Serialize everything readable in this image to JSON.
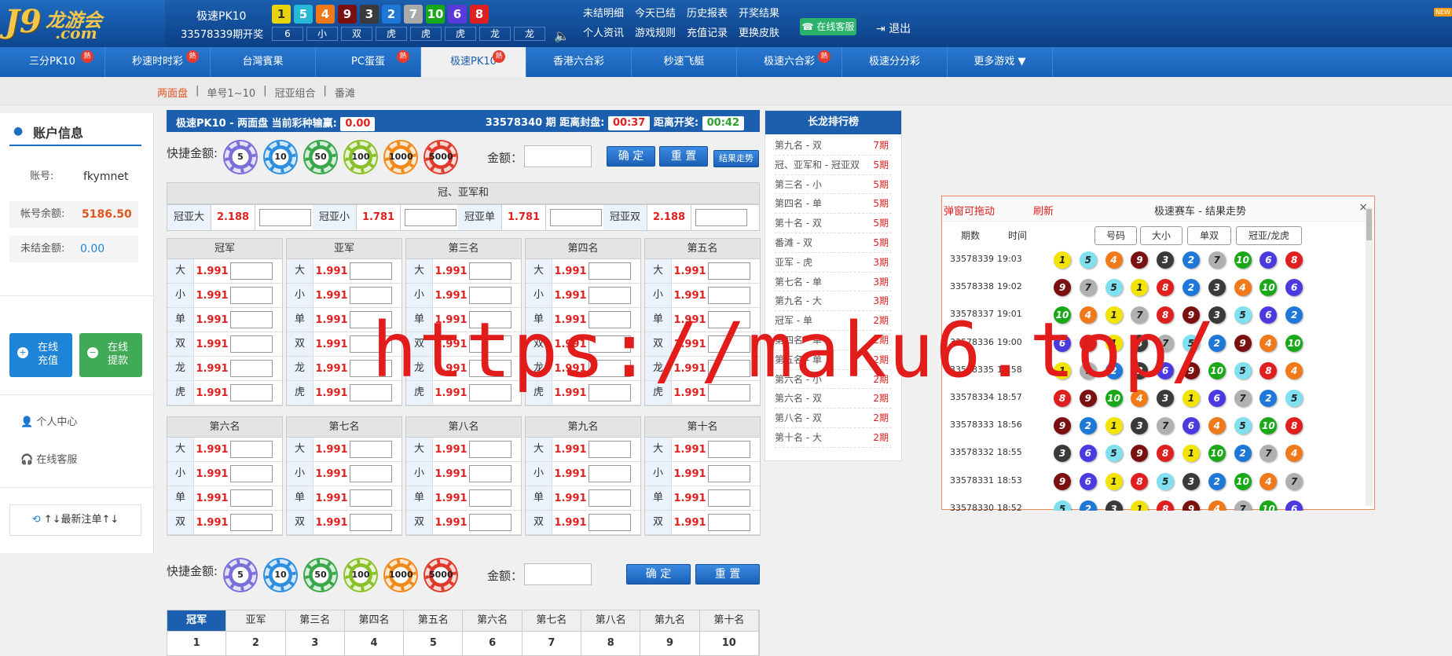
{
  "header": {
    "logo_main": "J9",
    "logo_sub": "龙游会",
    "logo_dot": ".com",
    "game": "极速PK10",
    "issue_open": "33578339期开奖",
    "balls": [
      {
        "n": "1",
        "c": "#e8d40a"
      },
      {
        "n": "5",
        "c": "#27b8d8"
      },
      {
        "n": "4",
        "c": "#f07a1a"
      },
      {
        "n": "9",
        "c": "#7a1010"
      },
      {
        "n": "3",
        "c": "#3a3a3a"
      },
      {
        "n": "2",
        "c": "#1e78d8"
      },
      {
        "n": "7",
        "c": "#aaaaaa"
      },
      {
        "n": "10",
        "c": "#18a818"
      },
      {
        "n": "6",
        "c": "#5a3ad8"
      },
      {
        "n": "8",
        "c": "#e02020"
      }
    ],
    "labels": [
      "6",
      "小",
      "双",
      "虎",
      "虎",
      "虎",
      "龙",
      "龙"
    ],
    "links": [
      "未结明细",
      "今天已结",
      "历史报表",
      "开奖结果",
      "个人资讯",
      "游戏规则",
      "充值记录",
      "更换皮肤"
    ],
    "service": "在线客服",
    "logout": "退出",
    "new_tag": "NEW"
  },
  "nav": [
    {
      "label": "三分PK10",
      "hot": true
    },
    {
      "label": "秒速时时彩",
      "hot": true
    },
    {
      "label": "台灣賓果",
      "hot": false
    },
    {
      "label": "PC蛋蛋",
      "hot": true
    },
    {
      "label": "极速PK10",
      "hot": true,
      "active": true
    },
    {
      "label": "香港六合彩",
      "hot": false
    },
    {
      "label": "秒速飞艇",
      "hot": false
    },
    {
      "label": "极速六合彩",
      "hot": true
    },
    {
      "label": "极速分分彩",
      "hot": false
    },
    {
      "label": "更多游戏 ▼",
      "hot": false
    }
  ],
  "hot_label": "熱",
  "subnav": {
    "items": [
      "两面盘",
      "单号1~10",
      "冠亚组合",
      "番滩"
    ],
    "sep": "|"
  },
  "sidebar": {
    "title": "账户信息",
    "account_k": "账号:",
    "account_v": "fkymnet",
    "balance_k": "帐号余额:",
    "balance_v": "5186.50",
    "unsettled_k": "未结金额:",
    "unsettled_v": "0.00",
    "recharge": "在线充值",
    "withdraw": "在线提款",
    "center": "个人中心",
    "support": "在线客服",
    "latest": "↑↓最新注单↑↓"
  },
  "mainbar": {
    "left": "极速PK10 - 两面盘  当前彩种输赢:",
    "winloss": "0.00",
    "issue": "33578340 期 距离封盘:",
    "close": "00:37",
    "open_lbl": "距离开奖:",
    "open": "00:42"
  },
  "quick": {
    "label": "快捷金额:",
    "chips": [
      "5",
      "10",
      "50",
      "100",
      "1000",
      "5000"
    ],
    "amount_label": "金额：",
    "confirm": "确 定",
    "reset": "重 置",
    "trend": "结果走势"
  },
  "gy": {
    "title": "冠、亚军和",
    "items": [
      [
        "冠亚大",
        "2.188"
      ],
      [
        "冠亚小",
        "1.781"
      ],
      [
        "冠亚单",
        "1.781"
      ],
      [
        "冠亚双",
        "2.188"
      ]
    ]
  },
  "groups_top": [
    "冠军",
    "亚军",
    "第三名",
    "第四名",
    "第五名"
  ],
  "groups_bottom": [
    "第六名",
    "第七名",
    "第八名",
    "第九名",
    "第十名"
  ],
  "keys_top": [
    "大",
    "小",
    "单",
    "双",
    "龙",
    "虎"
  ],
  "keys_bottom": [
    "大",
    "小",
    "单",
    "双"
  ],
  "odds": "1.991",
  "bottom_tabs": [
    "冠军",
    "亚军",
    "第三名",
    "第四名",
    "第五名",
    "第六名",
    "第七名",
    "第八名",
    "第九名",
    "第十名"
  ],
  "bottom_nums": [
    "1",
    "2",
    "3",
    "4",
    "5",
    "6",
    "7",
    "8",
    "9",
    "10"
  ],
  "longdragon": {
    "title": "长龙排行榜",
    "items": [
      [
        "第九名 - 双",
        "7期"
      ],
      [
        "冠、亚军和 - 冠亚双",
        "5期"
      ],
      [
        "第三名 - 小",
        "5期"
      ],
      [
        "第四名 - 单",
        "5期"
      ],
      [
        "第十名 - 双",
        "5期"
      ],
      [
        "番滩 - 双",
        "5期"
      ],
      [
        "亚军 - 虎",
        "3期"
      ],
      [
        "第七名 - 单",
        "3期"
      ],
      [
        "第九名 - 大",
        "3期"
      ],
      [
        "冠军 - 单",
        "2期"
      ],
      [
        "第四名 - 单",
        "2期"
      ],
      [
        "第五名 - 单",
        "2期"
      ],
      [
        "第六名 - 小",
        "2期"
      ],
      [
        "第六名 - 双",
        "2期"
      ],
      [
        "第八名 - 双",
        "2期"
      ],
      [
        "第十名 - 大",
        "2期"
      ]
    ]
  },
  "popup": {
    "drag": "弹窗可拖动",
    "refresh": "刷新",
    "title": "极速赛车 - 结果走势",
    "close": "×",
    "col_issue": "期数",
    "col_time": "时间",
    "tabs": [
      "号码",
      "大小",
      "单双",
      "冠亚/龙虎"
    ],
    "rows": [
      {
        "issue": "33578339",
        "time": "19:03",
        "b": [
          1,
          5,
          4,
          9,
          3,
          2,
          7,
          10,
          6,
          8
        ]
      },
      {
        "issue": "33578338",
        "time": "19:02",
        "b": [
          9,
          7,
          5,
          1,
          8,
          2,
          3,
          4,
          10,
          6
        ]
      },
      {
        "issue": "33578337",
        "time": "19:01",
        "b": [
          10,
          4,
          1,
          7,
          8,
          9,
          3,
          5,
          6,
          2
        ]
      },
      {
        "issue": "33578336",
        "time": "19:00",
        "b": [
          6,
          8,
          1,
          3,
          7,
          5,
          2,
          9,
          4,
          10
        ]
      },
      {
        "issue": "33578335",
        "time": "18:58",
        "b": [
          1,
          7,
          2,
          3,
          6,
          9,
          10,
          5,
          8,
          4
        ]
      },
      {
        "issue": "33578334",
        "time": "18:57",
        "b": [
          8,
          9,
          10,
          4,
          3,
          1,
          6,
          7,
          2,
          5
        ]
      },
      {
        "issue": "33578333",
        "time": "18:56",
        "b": [
          9,
          2,
          1,
          3,
          7,
          6,
          4,
          5,
          10,
          8
        ]
      },
      {
        "issue": "33578332",
        "time": "18:55",
        "b": [
          3,
          6,
          5,
          9,
          8,
          1,
          10,
          2,
          7,
          4
        ]
      },
      {
        "issue": "33578331",
        "time": "18:53",
        "b": [
          9,
          6,
          1,
          8,
          5,
          3,
          2,
          10,
          4,
          7
        ]
      },
      {
        "issue": "33578330",
        "time": "18:52",
        "b": [
          5,
          2,
          3,
          1,
          8,
          9,
          4,
          7,
          10,
          6
        ]
      }
    ]
  },
  "watermark": "https://maku6.top/"
}
